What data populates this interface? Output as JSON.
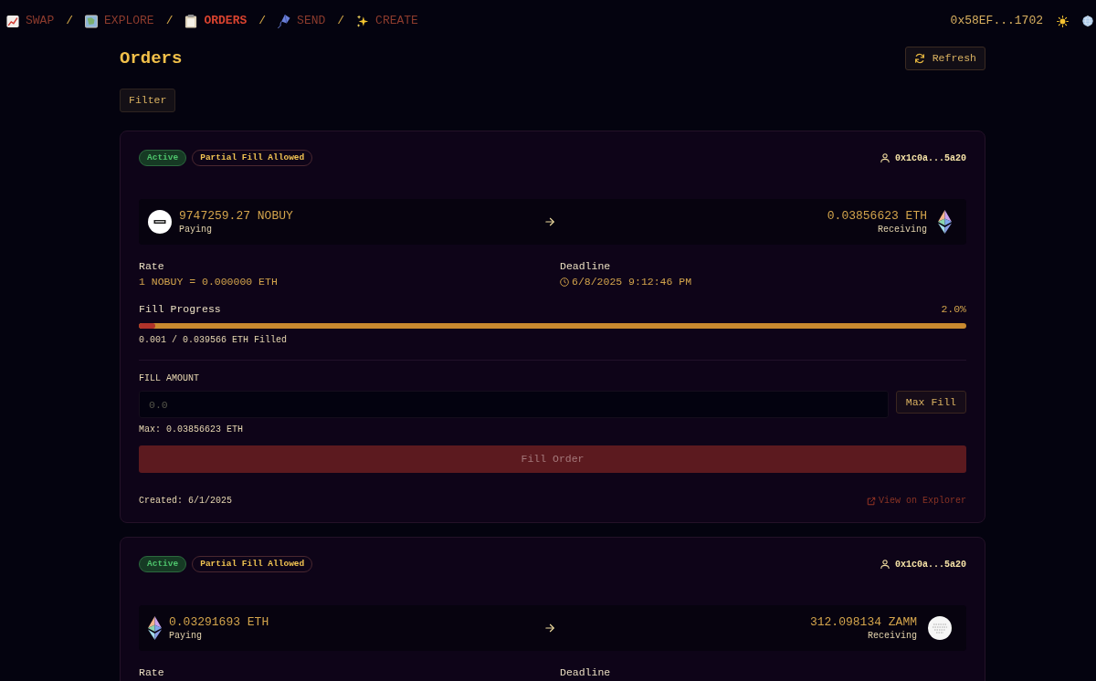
{
  "nav": {
    "items": [
      {
        "label": "SWAP",
        "selected": false,
        "separator": "/"
      },
      {
        "label": "EXPLORE",
        "selected": false,
        "separator": "/"
      },
      {
        "label": "ORDERS",
        "selected": true,
        "separator": "/"
      },
      {
        "label": "SEND",
        "selected": false,
        "separator": "/"
      },
      {
        "label": "CREATE",
        "selected": false
      }
    ],
    "wallet": "0x58EF...1702"
  },
  "page": {
    "title": "Orders",
    "refresh_button": "Refresh",
    "filter_button": "Filter"
  },
  "orders": [
    {
      "badges": [
        {
          "label": "Active",
          "kind": "status"
        },
        {
          "label": "Partial Fill Allowed",
          "kind": "flag"
        }
      ],
      "maker": "0x1c0a...5a20",
      "legs": [
        {
          "kind": "coin",
          "amount": "9747259.27 NOBUY",
          "caption": "Paying"
        },
        {
          "kind": "ether",
          "amount": "0.03856623 ETH",
          "caption": "Receiving"
        }
      ],
      "rate": {
        "label": "Rate",
        "value": "1 NOBUY = 0.000000 ETH"
      },
      "deadline": {
        "label": "Deadline",
        "value": "6/8/2025 9:12:46 PM"
      },
      "progress": {
        "label": "Fill Progress",
        "percent": "2.0%",
        "level": 0.02,
        "filled": "0.001 / 0.039566 ETH Filled"
      },
      "fill": {
        "label": "FILL AMOUNT",
        "placeholder": "0.0",
        "max_button": "Max Fill",
        "max_note": "Max: 0.03856623 ETH",
        "submit": {
          "label": "Fill Order",
          "disabled": true
        }
      },
      "created": "Created: 6/1/2025",
      "explorer_link": "View on Explorer"
    },
    {
      "badges": [
        {
          "label": "Active",
          "kind": "status"
        },
        {
          "label": "Partial Fill Allowed",
          "kind": "flag"
        }
      ],
      "maker": "0x1c0a...5a20",
      "legs": [
        {
          "kind": "ether",
          "amount": "0.03291693 ETH",
          "caption": "Paying"
        },
        {
          "kind": "sketch",
          "amount": "312.098134 ZAMM",
          "caption": "Receiving"
        }
      ],
      "rate": {
        "label": "Rate"
      },
      "deadline": {
        "label": "Deadline"
      }
    }
  ]
}
